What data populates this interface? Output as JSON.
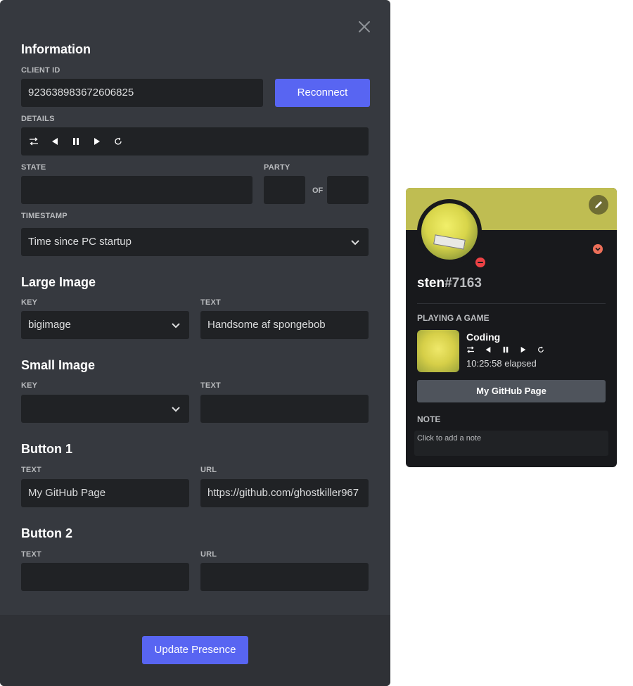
{
  "modal": {
    "information": {
      "title": "Information",
      "client_id_label": "CLIENT ID",
      "client_id_value": "923638983672606825",
      "reconnect_label": "Reconnect",
      "details_label": "DETAILS",
      "state_label": "STATE",
      "state_value": "",
      "party_label": "PARTY",
      "party_of_label": "OF",
      "party_current": "",
      "party_max": "",
      "timestamp_label": "TIMESTAMP",
      "timestamp_value": "Time since PC startup"
    },
    "large_image": {
      "title": "Large Image",
      "key_label": "KEY",
      "key_value": "bigimage",
      "text_label": "TEXT",
      "text_value": "Handsome af spongebob"
    },
    "small_image": {
      "title": "Small Image",
      "key_label": "KEY",
      "key_value": "",
      "text_label": "TEXT",
      "text_value": ""
    },
    "button1": {
      "title": "Button 1",
      "text_label": "TEXT",
      "text_value": "My GitHub Page",
      "url_label": "URL",
      "url_value": "https://github.com/ghostkiller967"
    },
    "button2": {
      "title": "Button 2",
      "text_label": "TEXT",
      "text_value": "",
      "url_label": "URL",
      "url_value": ""
    },
    "update_label": "Update Presence"
  },
  "profile": {
    "username": "sten",
    "discriminator": "#7163",
    "activity_label": "PLAYING A GAME",
    "game_name": "Coding",
    "elapsed": "10:25:58 elapsed",
    "button_label": "My GitHub Page",
    "note_label": "NOTE",
    "note_placeholder": "Click to add a note",
    "avatar_sign_text": "Professional Retard",
    "status": "do-not-disturb"
  },
  "colors": {
    "modal_bg": "#36393f",
    "footer_bg": "#2f3136",
    "input_bg": "#202225",
    "accent": "#5865f2",
    "banner": "#bfbd52",
    "dnd_red": "#ed4245"
  }
}
